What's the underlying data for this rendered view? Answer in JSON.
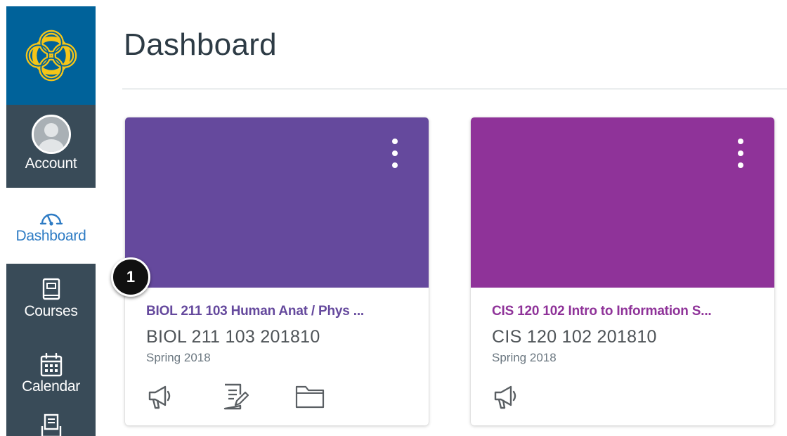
{
  "nav": {
    "account_label": "Account",
    "dashboard_label": "Dashboard",
    "courses_label": "Courses",
    "calendar_label": "Calendar",
    "colors": {
      "logo_bg": "#00629a",
      "nav_bg": "#394b58",
      "active_text": "#2d7bc4",
      "logo_gold": "#f5c518"
    }
  },
  "page": {
    "title": "Dashboard"
  },
  "callout": {
    "number": "1"
  },
  "cards": [
    {
      "title": "BIOL 211 103 Human Anat / Phys ...",
      "code": "BIOL 211 103 201810",
      "term": "Spring 2018",
      "hero_color": "#65499d",
      "title_color": "#65499d",
      "actions": [
        "announcements-icon",
        "assignments-icon",
        "files-icon"
      ]
    },
    {
      "title": "CIS 120 102 Intro to Information S...",
      "code": "CIS 120 102 201810",
      "term": "Spring 2018",
      "hero_color": "#8f3399",
      "title_color": "#8f3399",
      "actions": [
        "announcements-icon"
      ]
    }
  ]
}
